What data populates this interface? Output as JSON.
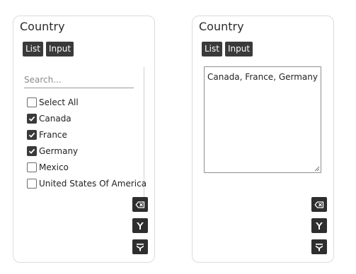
{
  "list_panel": {
    "title": "Country",
    "tabs": [
      {
        "label": "List"
      },
      {
        "label": "Input"
      }
    ],
    "search_placeholder": "Search...",
    "options": [
      {
        "label": "Select All",
        "checked": false
      },
      {
        "label": "Canada",
        "checked": true
      },
      {
        "label": "France",
        "checked": true
      },
      {
        "label": "Germany",
        "checked": true
      },
      {
        "label": "Mexico",
        "checked": false
      },
      {
        "label": "United States Of America",
        "checked": false
      }
    ],
    "actions": [
      {
        "icon": "clear-icon"
      },
      {
        "icon": "filter-icon"
      },
      {
        "icon": "filter-exclude-icon"
      }
    ]
  },
  "input_panel": {
    "title": "Country",
    "tabs": [
      {
        "label": "List"
      },
      {
        "label": "Input"
      }
    ],
    "value": "Canada, France, Germany",
    "actions": [
      {
        "icon": "clear-icon"
      },
      {
        "icon": "filter-icon"
      },
      {
        "icon": "filter-exclude-icon"
      }
    ]
  }
}
